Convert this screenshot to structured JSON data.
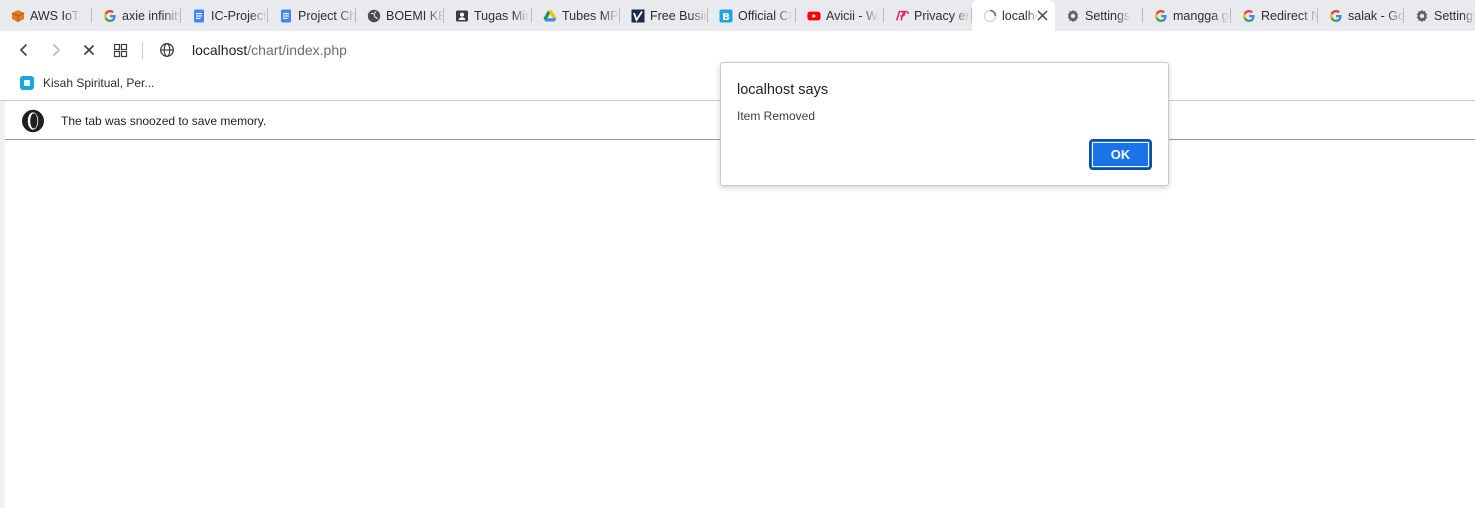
{
  "tabs": [
    {
      "title": "AWS IoT",
      "icon": "aws-cube-icon"
    },
    {
      "title": "axie infinity",
      "icon": "google-g-icon"
    },
    {
      "title": "IC-Project",
      "icon": "google-docs-icon"
    },
    {
      "title": "Project Ch",
      "icon": "google-docs-icon"
    },
    {
      "title": "BOEMI KE",
      "icon": "globe-icon"
    },
    {
      "title": "Tugas Mir",
      "icon": "contact-card-icon"
    },
    {
      "title": "Tubes MP",
      "icon": "google-drive-icon"
    },
    {
      "title": "Free Busin",
      "icon": "checkmark-logo-icon"
    },
    {
      "title": "Official CI",
      "icon": "b-logo-icon"
    },
    {
      "title": "Avicii - W",
      "icon": "youtube-icon"
    },
    {
      "title": "Privacy er",
      "icon": "privacy-logo-icon"
    },
    {
      "title": "localhost",
      "icon": "loading-spinner-icon",
      "active": true
    },
    {
      "title": "Settings",
      "icon": "gear-icon"
    },
    {
      "title": "mangga g",
      "icon": "google-g-icon"
    },
    {
      "title": "Redirect N",
      "icon": "google-g-icon"
    },
    {
      "title": "salak - Go",
      "icon": "google-g-icon"
    },
    {
      "title": "Settings",
      "icon": "gear-icon"
    }
  ],
  "address_bar": {
    "host": "localhost",
    "path": "/chart/index.php"
  },
  "bookmarks": [
    {
      "label": "Kisah Spiritual, Per..."
    }
  ],
  "snooze_bar": {
    "message": "The tab was snoozed to save memory."
  },
  "dialog": {
    "title": "localhost says",
    "message": "Item Removed",
    "ok_label": "OK"
  },
  "colors": {
    "accent": "#1a73e8",
    "tabstrip_bg": "#e8eaee",
    "opera_red": "#1f1f1f"
  }
}
